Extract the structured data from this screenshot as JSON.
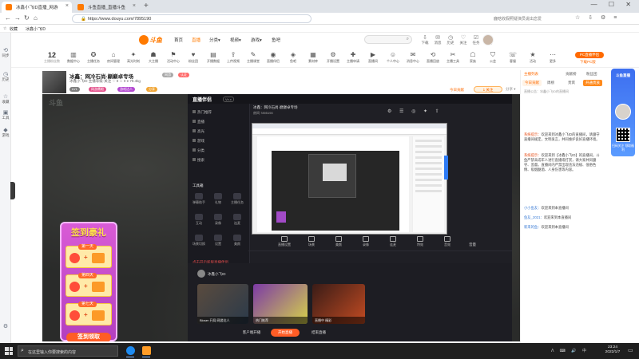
{
  "browser": {
    "tabs": [
      {
        "title": "冰鑫小飞ID直播_网游"
      },
      {
        "title": "斗鱼直播_直播斗鱼"
      }
    ],
    "new_tab": "+",
    "window_controls": "— ☐ ✕",
    "url": "https://www.douyu.com/7895190",
    "right_search": "鹿晗收假照疑演员说出恋爱",
    "tools": "☆ ⇩ ⚙ ≡",
    "bookmarks": [
      {
        "label": "收藏"
      },
      {
        "label": "冰鑫小飞ID"
      }
    ]
  },
  "browser_sidebar": [
    {
      "label": "同步"
    },
    {
      "label": "历史"
    },
    {
      "label": "收藏"
    },
    {
      "label": "工具"
    },
    {
      "label": "游戏"
    }
  ],
  "header": {
    "logo": "斗鱼",
    "nav": [
      {
        "label": "首页"
      },
      {
        "label": "直播"
      },
      {
        "label": "分类▾"
      },
      {
        "label": "视频▾"
      },
      {
        "label": "游戏▾"
      },
      {
        "label": "鱼吧"
      }
    ],
    "icons": [
      {
        "label": "下载"
      },
      {
        "label": "消息"
      },
      {
        "label": "历史"
      },
      {
        "label": "关注"
      },
      {
        "label": "任务"
      },
      {
        "label": "开播"
      }
    ]
  },
  "categories": {
    "fans_count": "12",
    "fans_label": "主播粉丝数",
    "items": [
      {
        "label": "数据中心"
      },
      {
        "label": "主播任务"
      },
      {
        "label": "房间管理"
      },
      {
        "label": "高光时刻"
      },
      {
        "label": "大主播"
      },
      {
        "label": "活动中心"
      },
      {
        "label": "粉丝团"
      },
      {
        "label": "开播数据"
      },
      {
        "label": "上传视频"
      },
      {
        "label": "主播课堂"
      },
      {
        "label": "直播伴侣"
      },
      {
        "label": "鱼吧"
      },
      {
        "label": "素材库"
      },
      {
        "label": "开播设置"
      },
      {
        "label": "主播申请"
      },
      {
        "label": "直播间"
      },
      {
        "label": "个人中心"
      },
      {
        "label": "消息中心"
      },
      {
        "label": "直播回放"
      },
      {
        "label": "主播工具"
      },
      {
        "label": "家族"
      },
      {
        "label": "公会"
      },
      {
        "label": "客服"
      },
      {
        "label": "活动"
      },
      {
        "label": "更多"
      }
    ],
    "pc_button": "PC直播伴侣",
    "pc_link": "下载PC版"
  },
  "room": {
    "title": "冰鑫：网冷石尚·巅巅卓专场",
    "tags": [
      {
        "label": "网游",
        "color": "#a8a8a8"
      },
      {
        "label": "认证",
        "color": "#ff6a6a"
      }
    ],
    "meta": "冰鑫小飞ID   主播等级·关注   ♡ 0   ☆ 0   ⌖ 79.4kg",
    "badges": [
      {
        "label": "LV1",
        "color": "#7f7f7f"
      },
      {
        "label": "网游鹰眼",
        "color": "#e3508a"
      },
      {
        "label": "游戏达人",
        "color": "#b44ad2"
      },
      {
        "label": "分享",
        "color": "#f0a534"
      }
    ],
    "rank": "今日贡献",
    "follow": "1 关注",
    "report": "分享 ▾"
  },
  "video": {
    "watermark": "斗鱼",
    "sign": {
      "title": "签到豪礼",
      "days": [
        {
          "label": "第一天"
        },
        {
          "label": "第四天"
        },
        {
          "label": "第七天"
        }
      ],
      "button": "签到领取"
    },
    "inner": {
      "logo": "直播伴侣",
      "version": "Vx.x",
      "menu": [
        {
          "label": "热门推荐"
        },
        {
          "label": "直播"
        },
        {
          "label": "高光"
        },
        {
          "label": "游戏"
        },
        {
          "label": "分类"
        },
        {
          "label": "搜索"
        }
      ],
      "tools_title": "工具箱",
      "tools": [
        {
          "label": "弹幕助手"
        },
        {
          "label": "礼物"
        },
        {
          "label": "主播任务"
        },
        {
          "label": "互动"
        },
        {
          "label": "录像"
        },
        {
          "label": "连麦"
        },
        {
          "label": "场景切换"
        },
        {
          "label": "设置"
        },
        {
          "label": "美颜"
        }
      ],
      "title": "冰鑫：网冷石尚·巅巅卓专场",
      "room_line": "房间 7895190",
      "toolbar": [
        {
          "label": "直播设置"
        },
        {
          "label": "场景"
        },
        {
          "label": "美颜"
        },
        {
          "label": "录像"
        },
        {
          "label": "连麦"
        },
        {
          "label": "特效"
        },
        {
          "label": "音效"
        }
      ],
      "volume": "音量",
      "bottom_note": "点击开启新版直播伴侣",
      "user_name": "冰鑫小飞ID",
      "cards": [
        {
          "caption": "Bloser 开局 网游达人",
          "count": ""
        },
        {
          "caption": "热门推荐",
          "count": ""
        },
        {
          "caption": "直播中 精彩",
          "count": ""
        }
      ],
      "btn_left": "客户端开播",
      "btn_mid": "开始直播",
      "btn_right": "结束直播"
    }
  },
  "chat": {
    "tabs": [
      {
        "label": "主播列表"
      },
      {
        "label": "贡献榜"
      },
      {
        "label": "粉丝团"
      }
    ],
    "subtabs": [
      {
        "label": "今日贡献"
      },
      {
        "label": "周榜"
      },
      {
        "label": "贵宾"
      },
      {
        "label": "开通贵族"
      }
    ],
    "notice": "直播公告：冰鑫小飞ID的直播间",
    "lines": [
      {
        "user": "系统提示：",
        "text": "欢迎来到冰鑫小飞ID的直播间，请遵守直播间规定，文明发言，共同维护良好直播环境。",
        "sys": true
      },
      {
        "user": "系统提示：",
        "text": "欢迎来到【冰鑫小飞ID】的直播间，斗鱼严禁未成年人进行直播或打赏，请大家共同遵守、监督。直播间内严禁出现违法违规、低俗色情、吸烟酗酒、人身伤害等内容。",
        "sys": true
      },
      {
        "user": "小小鱼友：",
        "text": "欢迎来到本直播间",
        "sys": false
      },
      {
        "user": "鱼友_2021：",
        "text": "欢迎来到本直播间",
        "sys": false
      },
      {
        "user": "新来的鱼：",
        "text": "欢迎来到本直播间",
        "sys": false
      }
    ]
  },
  "promo": {
    "title": "斗鱼直播",
    "text": "扫码关注 领取福利"
  },
  "taskbar": {
    "search_placeholder": "在这里输入你要搜索的内容",
    "apps": [
      {
        "name": "browser",
        "color": "#1e8bf0"
      },
      {
        "name": "douyu",
        "color": "#ff9c27"
      }
    ],
    "tray": "ᐱ ⌨ 🔊 中",
    "time": "23:24",
    "date": "2022/1/7"
  },
  "colors": {
    "accent": "#ff7a00",
    "taskbar": "#1f1f1f"
  }
}
